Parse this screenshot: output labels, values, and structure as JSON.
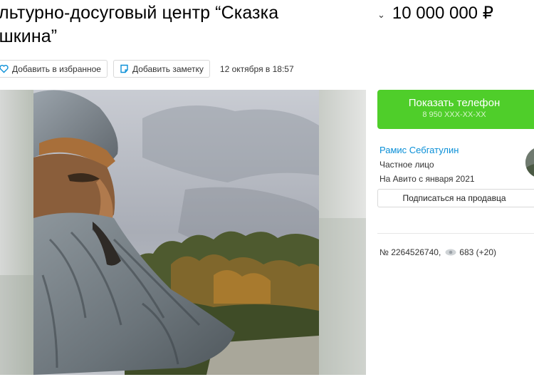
{
  "listing": {
    "title": "ультурно-досуговый центр “Сказка ушкина”",
    "price": "10 000 000 ₽",
    "date": "12 октября в 18:57",
    "number": "№ 2264526740,",
    "views": "683 (+20)"
  },
  "actions": {
    "favorite_label": "Добавить в избранное",
    "note_label": "Добавить заметку"
  },
  "contact": {
    "phone_button_label": "Показать телефон",
    "phone_masked": "8 950 XXX-XX-XX"
  },
  "seller": {
    "name": "Рамис Себгатулин",
    "type": "Частное лицо",
    "since": "На Авито с января 2021",
    "subscribe_label": "Подписаться на продавца"
  },
  "colors": {
    "accent_green": "#4fce2a",
    "link_blue": "#0a8fd7"
  },
  "icons": {
    "price_toggle": "chevron-down-icon",
    "favorite": "heart-icon",
    "note": "note-icon",
    "views": "eye-icon"
  }
}
